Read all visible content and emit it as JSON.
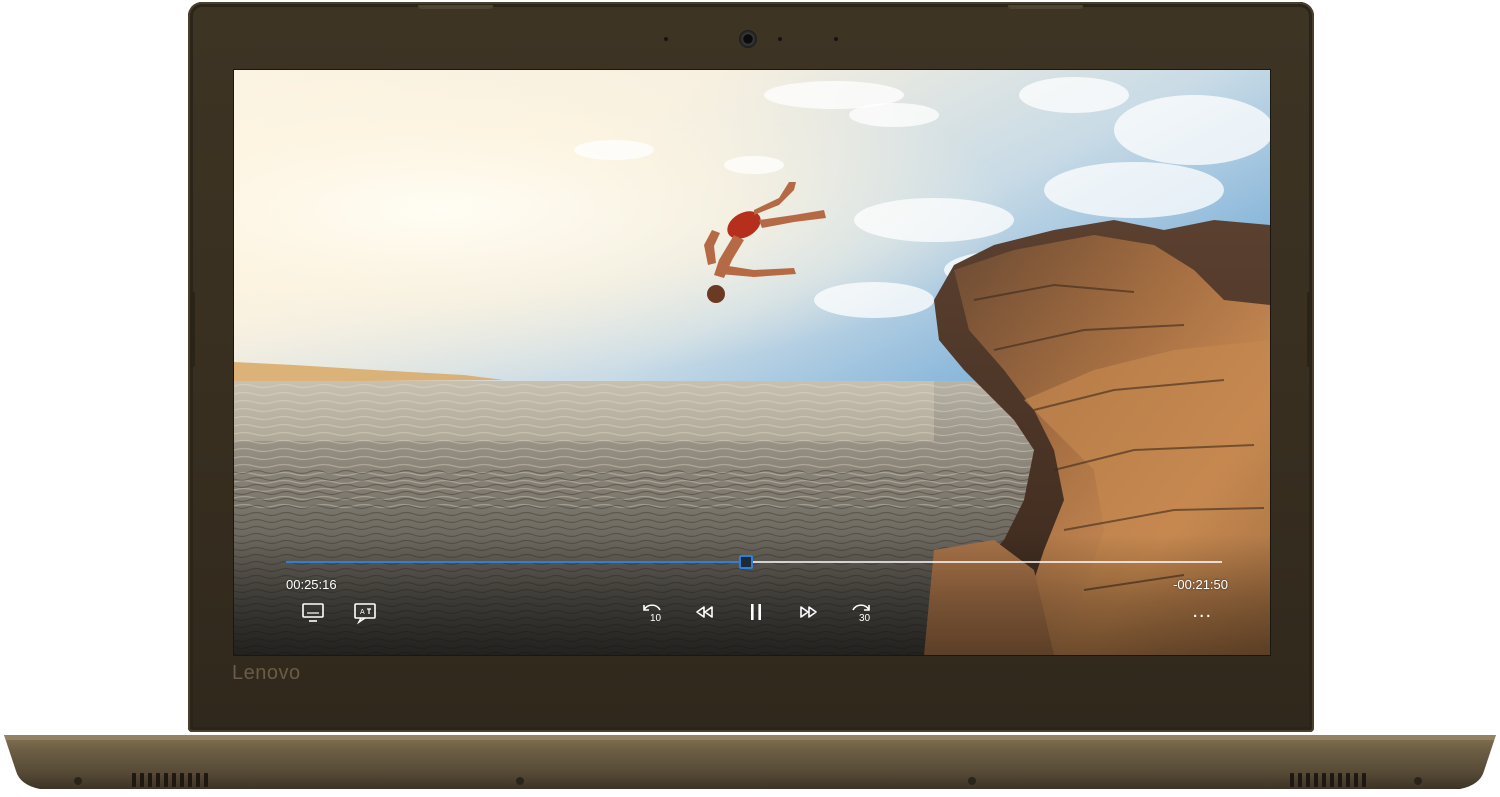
{
  "device": {
    "brand_logo": "Lenovo",
    "colors": {
      "lid": "#372e20",
      "base": "#5a4e38",
      "accent": "#2f7fd6"
    }
  },
  "player": {
    "elapsed": "00:25:16",
    "remaining": "-00:21:50",
    "progress": 0.49,
    "skip_back_seconds": "10",
    "skip_forward_seconds": "30",
    "more_label": "...",
    "icons": {
      "cast": "cast-to-device-icon",
      "subtitles": "closed-captions-icon",
      "skip_back": "skip-back-10-icon",
      "rewind": "rewind-icon",
      "pause": "pause-icon",
      "fast_forward": "fast-forward-icon",
      "skip_forward": "skip-forward-30-icon",
      "more": "more-options-icon"
    }
  }
}
